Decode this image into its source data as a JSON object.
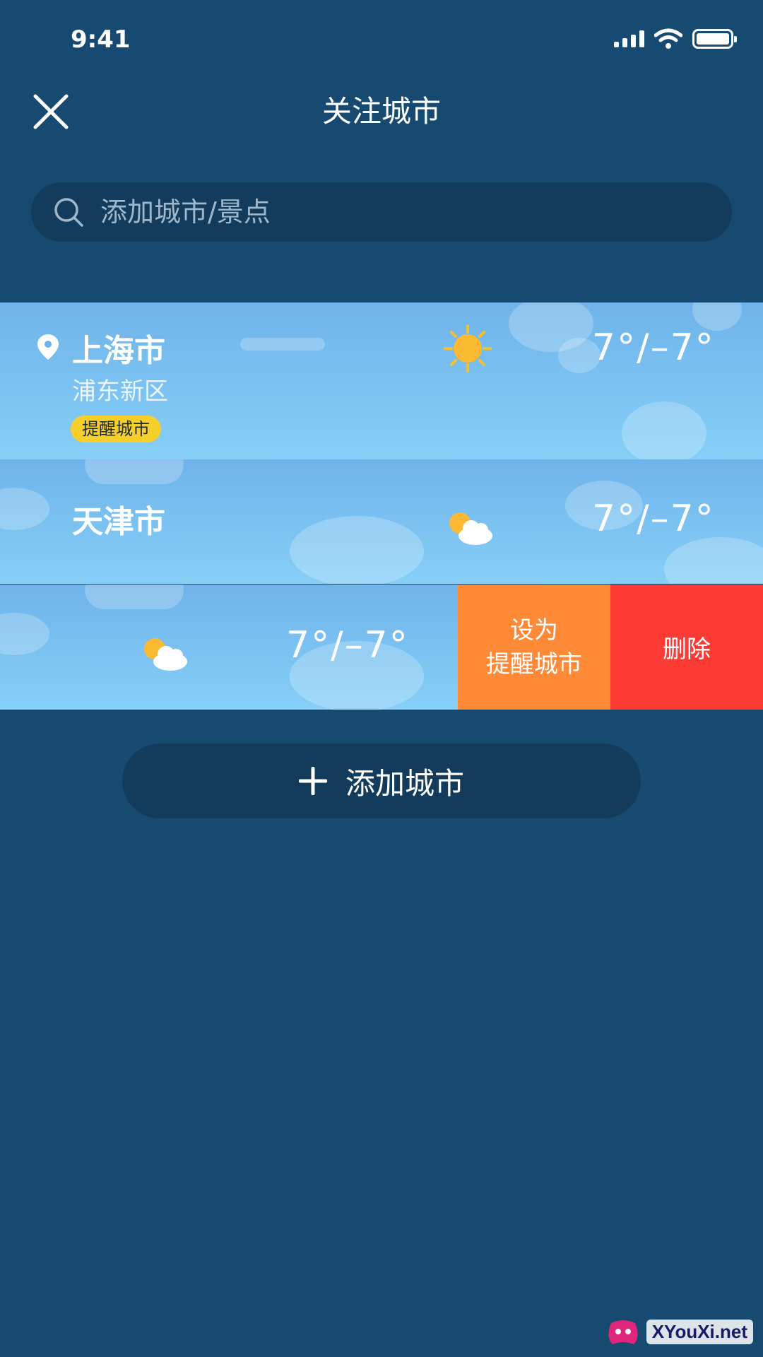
{
  "status_bar": {
    "time": "9:41"
  },
  "header": {
    "title": "关注城市",
    "close_icon": "close-icon"
  },
  "search": {
    "placeholder": "添加城市/景点",
    "icon": "search-icon"
  },
  "cities": [
    {
      "name": "上海市",
      "district": "浦东新区",
      "badge": "提醒城市",
      "temp": "7°/–7°",
      "weather_icon": "sun-icon",
      "located": true
    },
    {
      "name": "天津市",
      "temp": "7°/–7°",
      "weather_icon": "partly-cloudy-icon"
    },
    {
      "temp": "7°/–7°",
      "weather_icon": "partly-cloudy-icon",
      "actions": {
        "set_remind": [
          "设为",
          "提醒城市"
        ],
        "delete": "删除"
      }
    }
  ],
  "add_button": {
    "label": "添加城市",
    "icon": "plus-icon"
  },
  "colors": {
    "background": "#174a70",
    "search_bg": "#133c5c",
    "badge": "#f7cf2a",
    "action_set": "#fe8a38",
    "action_delete": "#fd3b35"
  },
  "watermark": {
    "text": "XYouXi.net"
  }
}
